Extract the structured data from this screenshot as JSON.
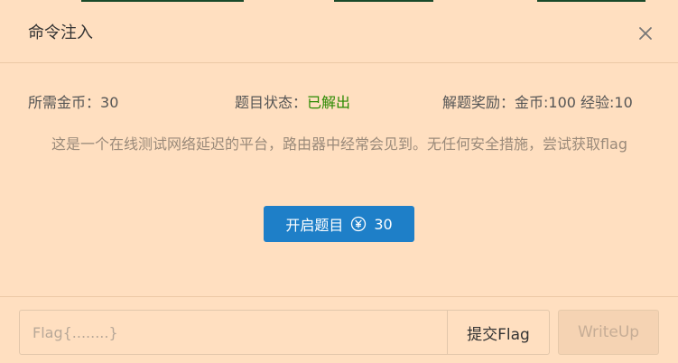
{
  "modal": {
    "title": "命令注入",
    "close_icon": "close-icon"
  },
  "info": {
    "cost_label": "所需金币：",
    "cost_value": "30",
    "status_label": "题目状态：",
    "status_value": "已解出",
    "reward_label": "解题奖励：",
    "reward_value": "金币:100 经验:10"
  },
  "description": "这是一个在线测试网络延迟的平台，路由器中经常会见到。无任何安全措施，尝试获取flag",
  "start_button": {
    "label": "开启题目",
    "coin_icon": "yuan-coin-icon",
    "cost": "30"
  },
  "footer": {
    "flag_placeholder": "Flag{........}",
    "flag_value": "",
    "submit_label": "提交Flag",
    "writeup_label": "WriteUp"
  },
  "colors": {
    "background": "#ffdfc0",
    "primary": "#1e7fc8",
    "status_solved": "#2a8a00",
    "text": "#333333",
    "muted": "#9a8a7a"
  }
}
